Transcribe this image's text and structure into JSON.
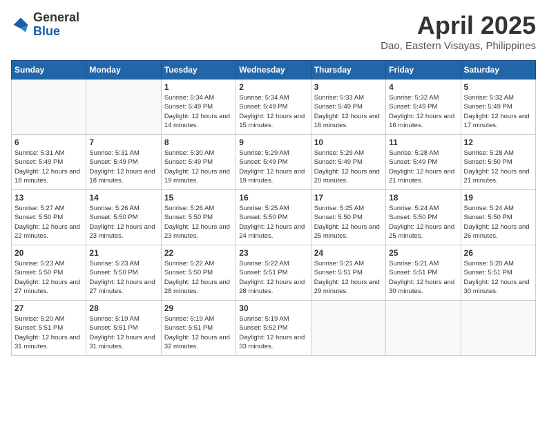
{
  "header": {
    "logo_general": "General",
    "logo_blue": "Blue",
    "month": "April 2025",
    "location": "Dao, Eastern Visayas, Philippines"
  },
  "days_of_week": [
    "Sunday",
    "Monday",
    "Tuesday",
    "Wednesday",
    "Thursday",
    "Friday",
    "Saturday"
  ],
  "weeks": [
    [
      {
        "day": "",
        "info": ""
      },
      {
        "day": "",
        "info": ""
      },
      {
        "day": "1",
        "info": "Sunrise: 5:34 AM\nSunset: 5:49 PM\nDaylight: 12 hours and 14 minutes."
      },
      {
        "day": "2",
        "info": "Sunrise: 5:34 AM\nSunset: 5:49 PM\nDaylight: 12 hours and 15 minutes."
      },
      {
        "day": "3",
        "info": "Sunrise: 5:33 AM\nSunset: 5:49 PM\nDaylight: 12 hours and 16 minutes."
      },
      {
        "day": "4",
        "info": "Sunrise: 5:32 AM\nSunset: 5:49 PM\nDaylight: 12 hours and 16 minutes."
      },
      {
        "day": "5",
        "info": "Sunrise: 5:32 AM\nSunset: 5:49 PM\nDaylight: 12 hours and 17 minutes."
      }
    ],
    [
      {
        "day": "6",
        "info": "Sunrise: 5:31 AM\nSunset: 5:49 PM\nDaylight: 12 hours and 18 minutes."
      },
      {
        "day": "7",
        "info": "Sunrise: 5:31 AM\nSunset: 5:49 PM\nDaylight: 12 hours and 18 minutes."
      },
      {
        "day": "8",
        "info": "Sunrise: 5:30 AM\nSunset: 5:49 PM\nDaylight: 12 hours and 19 minutes."
      },
      {
        "day": "9",
        "info": "Sunrise: 5:29 AM\nSunset: 5:49 PM\nDaylight: 12 hours and 19 minutes."
      },
      {
        "day": "10",
        "info": "Sunrise: 5:29 AM\nSunset: 5:49 PM\nDaylight: 12 hours and 20 minutes."
      },
      {
        "day": "11",
        "info": "Sunrise: 5:28 AM\nSunset: 5:49 PM\nDaylight: 12 hours and 21 minutes."
      },
      {
        "day": "12",
        "info": "Sunrise: 5:28 AM\nSunset: 5:50 PM\nDaylight: 12 hours and 21 minutes."
      }
    ],
    [
      {
        "day": "13",
        "info": "Sunrise: 5:27 AM\nSunset: 5:50 PM\nDaylight: 12 hours and 22 minutes."
      },
      {
        "day": "14",
        "info": "Sunrise: 5:26 AM\nSunset: 5:50 PM\nDaylight: 12 hours and 23 minutes."
      },
      {
        "day": "15",
        "info": "Sunrise: 5:26 AM\nSunset: 5:50 PM\nDaylight: 12 hours and 23 minutes."
      },
      {
        "day": "16",
        "info": "Sunrise: 5:25 AM\nSunset: 5:50 PM\nDaylight: 12 hours and 24 minutes."
      },
      {
        "day": "17",
        "info": "Sunrise: 5:25 AM\nSunset: 5:50 PM\nDaylight: 12 hours and 25 minutes."
      },
      {
        "day": "18",
        "info": "Sunrise: 5:24 AM\nSunset: 5:50 PM\nDaylight: 12 hours and 25 minutes."
      },
      {
        "day": "19",
        "info": "Sunrise: 5:24 AM\nSunset: 5:50 PM\nDaylight: 12 hours and 26 minutes."
      }
    ],
    [
      {
        "day": "20",
        "info": "Sunrise: 5:23 AM\nSunset: 5:50 PM\nDaylight: 12 hours and 27 minutes."
      },
      {
        "day": "21",
        "info": "Sunrise: 5:23 AM\nSunset: 5:50 PM\nDaylight: 12 hours and 27 minutes."
      },
      {
        "day": "22",
        "info": "Sunrise: 5:22 AM\nSunset: 5:50 PM\nDaylight: 12 hours and 28 minutes."
      },
      {
        "day": "23",
        "info": "Sunrise: 5:22 AM\nSunset: 5:51 PM\nDaylight: 12 hours and 28 minutes."
      },
      {
        "day": "24",
        "info": "Sunrise: 5:21 AM\nSunset: 5:51 PM\nDaylight: 12 hours and 29 minutes."
      },
      {
        "day": "25",
        "info": "Sunrise: 5:21 AM\nSunset: 5:51 PM\nDaylight: 12 hours and 30 minutes."
      },
      {
        "day": "26",
        "info": "Sunrise: 5:20 AM\nSunset: 5:51 PM\nDaylight: 12 hours and 30 minutes."
      }
    ],
    [
      {
        "day": "27",
        "info": "Sunrise: 5:20 AM\nSunset: 5:51 PM\nDaylight: 12 hours and 31 minutes."
      },
      {
        "day": "28",
        "info": "Sunrise: 5:19 AM\nSunset: 5:51 PM\nDaylight: 12 hours and 31 minutes."
      },
      {
        "day": "29",
        "info": "Sunrise: 5:19 AM\nSunset: 5:51 PM\nDaylight: 12 hours and 32 minutes."
      },
      {
        "day": "30",
        "info": "Sunrise: 5:19 AM\nSunset: 5:52 PM\nDaylight: 12 hours and 33 minutes."
      },
      {
        "day": "",
        "info": ""
      },
      {
        "day": "",
        "info": ""
      },
      {
        "day": "",
        "info": ""
      }
    ]
  ]
}
